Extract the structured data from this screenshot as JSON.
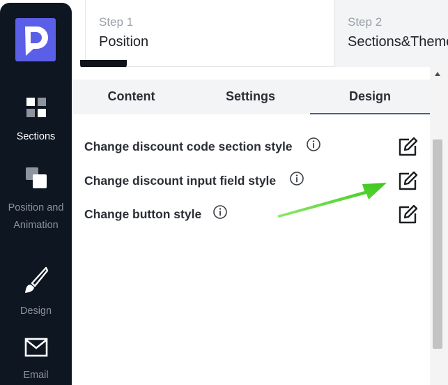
{
  "sidebar": {
    "items": [
      {
        "label": "Sections",
        "icon": "sections-icon",
        "active": true
      },
      {
        "label": "Position and Animation",
        "icon": "position-animation-icon",
        "active": false
      },
      {
        "label": "Design",
        "icon": "brush-icon",
        "active": false
      },
      {
        "label": "Email",
        "icon": "email-icon",
        "active": false
      }
    ],
    "logo_color": "#5b5fe8"
  },
  "steps": [
    {
      "number": "Step 1",
      "name": "Position",
      "active": true
    },
    {
      "number": "Step 2",
      "name": "Sections&Theme",
      "active": false
    }
  ],
  "tabs": [
    {
      "label": "Content",
      "active": false
    },
    {
      "label": "Settings",
      "active": false
    },
    {
      "label": "Design",
      "active": true
    }
  ],
  "design_options": [
    {
      "label": "Change discount code section style",
      "info_icon": "info-icon",
      "action_icon": "edit-icon"
    },
    {
      "label": "Change discount input field style",
      "info_icon": "info-icon",
      "action_icon": "edit-icon"
    },
    {
      "label": "Change button style",
      "info_icon": "info-icon",
      "action_icon": "edit-icon"
    }
  ],
  "colors": {
    "sidebar_bg": "#0e1621",
    "tab_active_underline": "#4a55a8",
    "annotation_arrow": "#46d21e"
  }
}
